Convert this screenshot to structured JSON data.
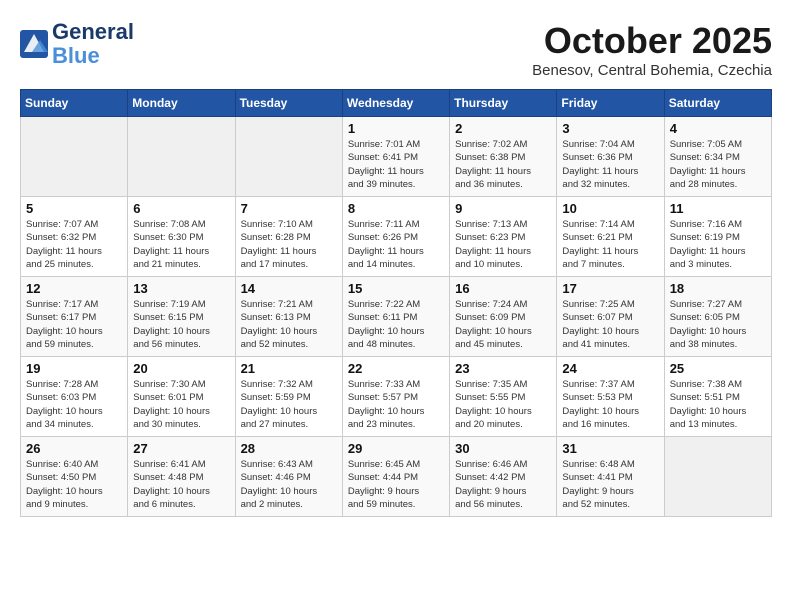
{
  "logo": {
    "line1": "General",
    "line2": "Blue"
  },
  "header": {
    "month": "October 2025",
    "location": "Benesov, Central Bohemia, Czechia"
  },
  "weekdays": [
    "Sunday",
    "Monday",
    "Tuesday",
    "Wednesday",
    "Thursday",
    "Friday",
    "Saturday"
  ],
  "weeks": [
    [
      {
        "day": "",
        "info": ""
      },
      {
        "day": "",
        "info": ""
      },
      {
        "day": "",
        "info": ""
      },
      {
        "day": "1",
        "info": "Sunrise: 7:01 AM\nSunset: 6:41 PM\nDaylight: 11 hours\nand 39 minutes."
      },
      {
        "day": "2",
        "info": "Sunrise: 7:02 AM\nSunset: 6:38 PM\nDaylight: 11 hours\nand 36 minutes."
      },
      {
        "day": "3",
        "info": "Sunrise: 7:04 AM\nSunset: 6:36 PM\nDaylight: 11 hours\nand 32 minutes."
      },
      {
        "day": "4",
        "info": "Sunrise: 7:05 AM\nSunset: 6:34 PM\nDaylight: 11 hours\nand 28 minutes."
      }
    ],
    [
      {
        "day": "5",
        "info": "Sunrise: 7:07 AM\nSunset: 6:32 PM\nDaylight: 11 hours\nand 25 minutes."
      },
      {
        "day": "6",
        "info": "Sunrise: 7:08 AM\nSunset: 6:30 PM\nDaylight: 11 hours\nand 21 minutes."
      },
      {
        "day": "7",
        "info": "Sunrise: 7:10 AM\nSunset: 6:28 PM\nDaylight: 11 hours\nand 17 minutes."
      },
      {
        "day": "8",
        "info": "Sunrise: 7:11 AM\nSunset: 6:26 PM\nDaylight: 11 hours\nand 14 minutes."
      },
      {
        "day": "9",
        "info": "Sunrise: 7:13 AM\nSunset: 6:23 PM\nDaylight: 11 hours\nand 10 minutes."
      },
      {
        "day": "10",
        "info": "Sunrise: 7:14 AM\nSunset: 6:21 PM\nDaylight: 11 hours\nand 7 minutes."
      },
      {
        "day": "11",
        "info": "Sunrise: 7:16 AM\nSunset: 6:19 PM\nDaylight: 11 hours\nand 3 minutes."
      }
    ],
    [
      {
        "day": "12",
        "info": "Sunrise: 7:17 AM\nSunset: 6:17 PM\nDaylight: 10 hours\nand 59 minutes."
      },
      {
        "day": "13",
        "info": "Sunrise: 7:19 AM\nSunset: 6:15 PM\nDaylight: 10 hours\nand 56 minutes."
      },
      {
        "day": "14",
        "info": "Sunrise: 7:21 AM\nSunset: 6:13 PM\nDaylight: 10 hours\nand 52 minutes."
      },
      {
        "day": "15",
        "info": "Sunrise: 7:22 AM\nSunset: 6:11 PM\nDaylight: 10 hours\nand 48 minutes."
      },
      {
        "day": "16",
        "info": "Sunrise: 7:24 AM\nSunset: 6:09 PM\nDaylight: 10 hours\nand 45 minutes."
      },
      {
        "day": "17",
        "info": "Sunrise: 7:25 AM\nSunset: 6:07 PM\nDaylight: 10 hours\nand 41 minutes."
      },
      {
        "day": "18",
        "info": "Sunrise: 7:27 AM\nSunset: 6:05 PM\nDaylight: 10 hours\nand 38 minutes."
      }
    ],
    [
      {
        "day": "19",
        "info": "Sunrise: 7:28 AM\nSunset: 6:03 PM\nDaylight: 10 hours\nand 34 minutes."
      },
      {
        "day": "20",
        "info": "Sunrise: 7:30 AM\nSunset: 6:01 PM\nDaylight: 10 hours\nand 30 minutes."
      },
      {
        "day": "21",
        "info": "Sunrise: 7:32 AM\nSunset: 5:59 PM\nDaylight: 10 hours\nand 27 minutes."
      },
      {
        "day": "22",
        "info": "Sunrise: 7:33 AM\nSunset: 5:57 PM\nDaylight: 10 hours\nand 23 minutes."
      },
      {
        "day": "23",
        "info": "Sunrise: 7:35 AM\nSunset: 5:55 PM\nDaylight: 10 hours\nand 20 minutes."
      },
      {
        "day": "24",
        "info": "Sunrise: 7:37 AM\nSunset: 5:53 PM\nDaylight: 10 hours\nand 16 minutes."
      },
      {
        "day": "25",
        "info": "Sunrise: 7:38 AM\nSunset: 5:51 PM\nDaylight: 10 hours\nand 13 minutes."
      }
    ],
    [
      {
        "day": "26",
        "info": "Sunrise: 6:40 AM\nSunset: 4:50 PM\nDaylight: 10 hours\nand 9 minutes."
      },
      {
        "day": "27",
        "info": "Sunrise: 6:41 AM\nSunset: 4:48 PM\nDaylight: 10 hours\nand 6 minutes."
      },
      {
        "day": "28",
        "info": "Sunrise: 6:43 AM\nSunset: 4:46 PM\nDaylight: 10 hours\nand 2 minutes."
      },
      {
        "day": "29",
        "info": "Sunrise: 6:45 AM\nSunset: 4:44 PM\nDaylight: 9 hours\nand 59 minutes."
      },
      {
        "day": "30",
        "info": "Sunrise: 6:46 AM\nSunset: 4:42 PM\nDaylight: 9 hours\nand 56 minutes."
      },
      {
        "day": "31",
        "info": "Sunrise: 6:48 AM\nSunset: 4:41 PM\nDaylight: 9 hours\nand 52 minutes."
      },
      {
        "day": "",
        "info": ""
      }
    ]
  ]
}
